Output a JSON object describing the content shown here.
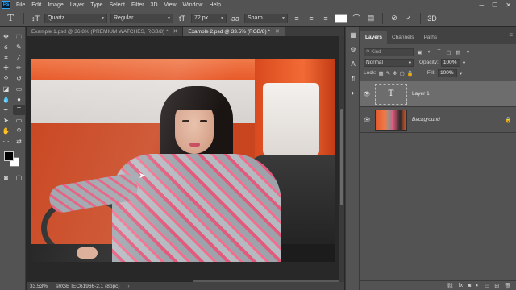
{
  "menubar": {
    "logo": "Ps",
    "items": [
      "File",
      "Edit",
      "Image",
      "Layer",
      "Type",
      "Select",
      "Filter",
      "3D",
      "View",
      "Window",
      "Help"
    ],
    "window_controls": [
      "─",
      "☐",
      "✕"
    ]
  },
  "options": {
    "tool_icon": "T",
    "orientation_icon": "↕T",
    "font_family": "Quartz",
    "font_style": "Regular",
    "size_icon": "tT",
    "font_size": "72 px",
    "aa_icon": "aa",
    "anti_alias": "Sharp",
    "align_buttons": [
      "align-left-icon",
      "align-center-icon",
      "align-right-icon"
    ],
    "text_color": "#ffffff",
    "action_icons": [
      "warp-text-icon",
      "character-panel-icon",
      "cancel-icon",
      "commit-icon",
      "3d-icon"
    ]
  },
  "tabs": [
    {
      "label": "Example 1.psd @ 36.8% (PREMIUM WATCHES, RGB/8) *",
      "active": false
    },
    {
      "label": "Example 2.psd @ 33.5% (RGB/8) *",
      "active": true
    }
  ],
  "status": {
    "zoom": "33.53%",
    "profile": "sRGB IEC61966-2.1 (8bpc)",
    "chevron": "›"
  },
  "panel": {
    "tabs": [
      {
        "label": "Layers",
        "active": true
      },
      {
        "label": "Channels",
        "active": false
      },
      {
        "label": "Paths",
        "active": false
      }
    ],
    "kind_label": "Kind",
    "blend_mode": "Normal",
    "opacity_label": "Opacity:",
    "opacity_value": "100%",
    "lock_label": "Lock:",
    "fill_label": "Fill:",
    "fill_value": "100%",
    "layers": [
      {
        "name": "Layer 1",
        "type": "text",
        "thumb_text": "T",
        "selected": true
      },
      {
        "name": "Background",
        "type": "photo",
        "selected": false,
        "locked": true
      }
    ]
  },
  "colors": {
    "fg": "#000000",
    "bg": "#ffffff",
    "accent": "#31a8ff"
  }
}
